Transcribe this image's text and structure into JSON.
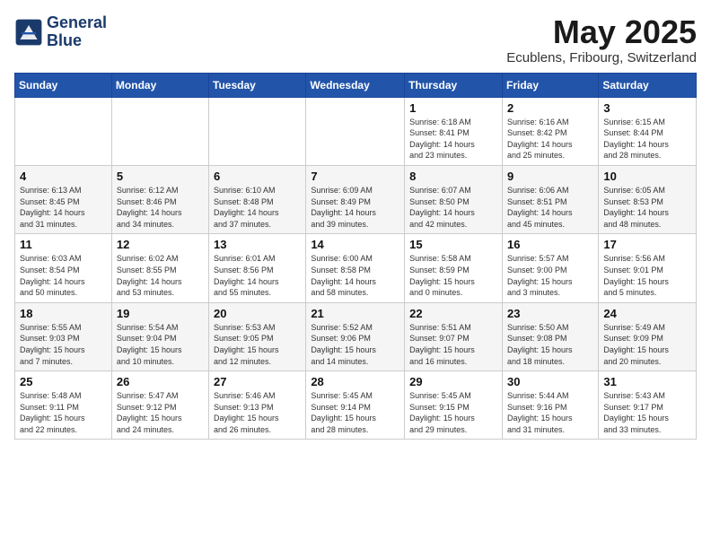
{
  "logo": {
    "line1": "General",
    "line2": "Blue"
  },
  "title": "May 2025",
  "location": "Ecublens, Fribourg, Switzerland",
  "days_of_week": [
    "Sunday",
    "Monday",
    "Tuesday",
    "Wednesday",
    "Thursday",
    "Friday",
    "Saturday"
  ],
  "weeks": [
    [
      {
        "day": "",
        "info": ""
      },
      {
        "day": "",
        "info": ""
      },
      {
        "day": "",
        "info": ""
      },
      {
        "day": "",
        "info": ""
      },
      {
        "day": "1",
        "info": "Sunrise: 6:18 AM\nSunset: 8:41 PM\nDaylight: 14 hours\nand 23 minutes."
      },
      {
        "day": "2",
        "info": "Sunrise: 6:16 AM\nSunset: 8:42 PM\nDaylight: 14 hours\nand 25 minutes."
      },
      {
        "day": "3",
        "info": "Sunrise: 6:15 AM\nSunset: 8:44 PM\nDaylight: 14 hours\nand 28 minutes."
      }
    ],
    [
      {
        "day": "4",
        "info": "Sunrise: 6:13 AM\nSunset: 8:45 PM\nDaylight: 14 hours\nand 31 minutes."
      },
      {
        "day": "5",
        "info": "Sunrise: 6:12 AM\nSunset: 8:46 PM\nDaylight: 14 hours\nand 34 minutes."
      },
      {
        "day": "6",
        "info": "Sunrise: 6:10 AM\nSunset: 8:48 PM\nDaylight: 14 hours\nand 37 minutes."
      },
      {
        "day": "7",
        "info": "Sunrise: 6:09 AM\nSunset: 8:49 PM\nDaylight: 14 hours\nand 39 minutes."
      },
      {
        "day": "8",
        "info": "Sunrise: 6:07 AM\nSunset: 8:50 PM\nDaylight: 14 hours\nand 42 minutes."
      },
      {
        "day": "9",
        "info": "Sunrise: 6:06 AM\nSunset: 8:51 PM\nDaylight: 14 hours\nand 45 minutes."
      },
      {
        "day": "10",
        "info": "Sunrise: 6:05 AM\nSunset: 8:53 PM\nDaylight: 14 hours\nand 48 minutes."
      }
    ],
    [
      {
        "day": "11",
        "info": "Sunrise: 6:03 AM\nSunset: 8:54 PM\nDaylight: 14 hours\nand 50 minutes."
      },
      {
        "day": "12",
        "info": "Sunrise: 6:02 AM\nSunset: 8:55 PM\nDaylight: 14 hours\nand 53 minutes."
      },
      {
        "day": "13",
        "info": "Sunrise: 6:01 AM\nSunset: 8:56 PM\nDaylight: 14 hours\nand 55 minutes."
      },
      {
        "day": "14",
        "info": "Sunrise: 6:00 AM\nSunset: 8:58 PM\nDaylight: 14 hours\nand 58 minutes."
      },
      {
        "day": "15",
        "info": "Sunrise: 5:58 AM\nSunset: 8:59 PM\nDaylight: 15 hours\nand 0 minutes."
      },
      {
        "day": "16",
        "info": "Sunrise: 5:57 AM\nSunset: 9:00 PM\nDaylight: 15 hours\nand 3 minutes."
      },
      {
        "day": "17",
        "info": "Sunrise: 5:56 AM\nSunset: 9:01 PM\nDaylight: 15 hours\nand 5 minutes."
      }
    ],
    [
      {
        "day": "18",
        "info": "Sunrise: 5:55 AM\nSunset: 9:03 PM\nDaylight: 15 hours\nand 7 minutes."
      },
      {
        "day": "19",
        "info": "Sunrise: 5:54 AM\nSunset: 9:04 PM\nDaylight: 15 hours\nand 10 minutes."
      },
      {
        "day": "20",
        "info": "Sunrise: 5:53 AM\nSunset: 9:05 PM\nDaylight: 15 hours\nand 12 minutes."
      },
      {
        "day": "21",
        "info": "Sunrise: 5:52 AM\nSunset: 9:06 PM\nDaylight: 15 hours\nand 14 minutes."
      },
      {
        "day": "22",
        "info": "Sunrise: 5:51 AM\nSunset: 9:07 PM\nDaylight: 15 hours\nand 16 minutes."
      },
      {
        "day": "23",
        "info": "Sunrise: 5:50 AM\nSunset: 9:08 PM\nDaylight: 15 hours\nand 18 minutes."
      },
      {
        "day": "24",
        "info": "Sunrise: 5:49 AM\nSunset: 9:09 PM\nDaylight: 15 hours\nand 20 minutes."
      }
    ],
    [
      {
        "day": "25",
        "info": "Sunrise: 5:48 AM\nSunset: 9:11 PM\nDaylight: 15 hours\nand 22 minutes."
      },
      {
        "day": "26",
        "info": "Sunrise: 5:47 AM\nSunset: 9:12 PM\nDaylight: 15 hours\nand 24 minutes."
      },
      {
        "day": "27",
        "info": "Sunrise: 5:46 AM\nSunset: 9:13 PM\nDaylight: 15 hours\nand 26 minutes."
      },
      {
        "day": "28",
        "info": "Sunrise: 5:45 AM\nSunset: 9:14 PM\nDaylight: 15 hours\nand 28 minutes."
      },
      {
        "day": "29",
        "info": "Sunrise: 5:45 AM\nSunset: 9:15 PM\nDaylight: 15 hours\nand 29 minutes."
      },
      {
        "day": "30",
        "info": "Sunrise: 5:44 AM\nSunset: 9:16 PM\nDaylight: 15 hours\nand 31 minutes."
      },
      {
        "day": "31",
        "info": "Sunrise: 5:43 AM\nSunset: 9:17 PM\nDaylight: 15 hours\nand 33 minutes."
      }
    ]
  ]
}
